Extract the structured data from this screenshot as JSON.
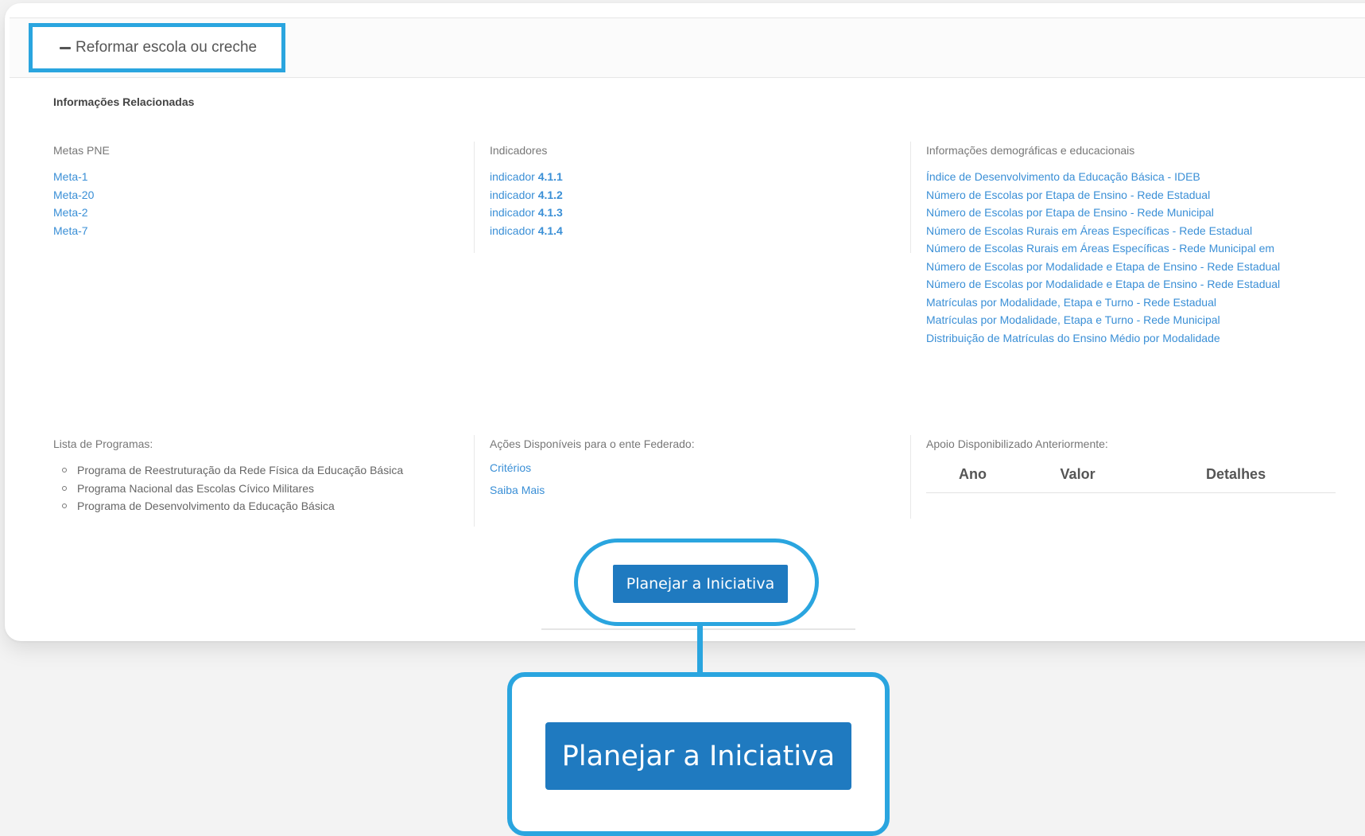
{
  "accordion": {
    "toggle_label": "Reformar escola ou creche"
  },
  "section_title": "Informações Relacionadas",
  "metas": {
    "label": "Metas PNE",
    "items": [
      "Meta-1",
      "Meta-20",
      "Meta-2",
      "Meta-7"
    ]
  },
  "indicadores": {
    "label": "Indicadores",
    "items": [
      {
        "prefix": "indicador ",
        "num": "4.1.1"
      },
      {
        "prefix": "indicador ",
        "num": "4.1.2"
      },
      {
        "prefix": "indicador ",
        "num": "4.1.3"
      },
      {
        "prefix": "indicador ",
        "num": "4.1.4"
      }
    ]
  },
  "demograficas": {
    "label": "Informações demográficas e educacionais",
    "items": [
      "Índice de Desenvolvimento da Educação Básica - IDEB",
      "Número de Escolas por Etapa de Ensino - Rede Estadual",
      "Número de Escolas por Etapa de Ensino - Rede Municipal",
      "Número de Escolas Rurais em Áreas Específicas - Rede Estadual",
      "Número de Escolas Rurais em Áreas Específicas - Rede Municipal em",
      "Número de Escolas por Modalidade e Etapa de Ensino - Rede Estadual",
      "Número de Escolas por Modalidade e Etapa de Ensino - Rede Estadual",
      "Matrículas por Modalidade, Etapa e Turno - Rede Estadual",
      "Matrículas por Modalidade, Etapa e Turno - Rede Municipal",
      "Distribuição de Matrículas do Ensino Médio por Modalidade"
    ]
  },
  "programas": {
    "label": "Lista de Programas:",
    "items": [
      "Programa de Reestruturação da Rede Física da Educação Básica",
      "Programa Nacional das Escolas Cívico Militares",
      "Programa de Desenvolvimento da Educação Básica"
    ]
  },
  "acoes": {
    "label": "Ações Disponíveis para o ente Federado:",
    "criterios": "Critérios",
    "saiba_mais": "Saiba Mais"
  },
  "apoio": {
    "label": "Apoio Disponibilizado Anteriormente:",
    "columns": [
      "Ano",
      "Valor",
      "Detalhes"
    ]
  },
  "plan_button": {
    "label": "Planejar a Iniciativa"
  },
  "zoom": {
    "plan_button_label": "Planejar a Iniciativa"
  },
  "colors": {
    "accent_highlight": "#2aa5df",
    "button_blue": "#1f7ac0",
    "link_blue": "#3a8fd6"
  }
}
